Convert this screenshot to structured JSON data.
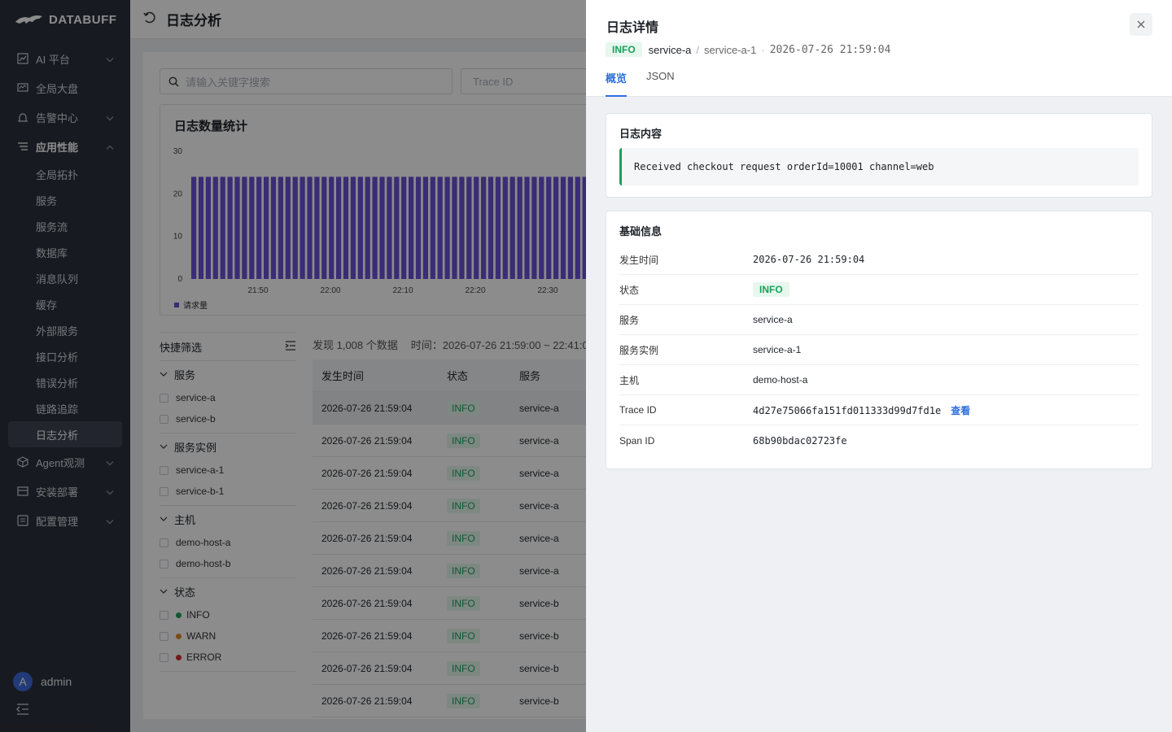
{
  "app": {
    "brand": "DATABUFF"
  },
  "sidebar": {
    "items": [
      {
        "label": "AI 平台"
      },
      {
        "label": "全局大盘"
      },
      {
        "label": "告警中心"
      },
      {
        "label": "应用性能"
      },
      {
        "label": "Agent观测"
      },
      {
        "label": "安装部署"
      },
      {
        "label": "配置管理"
      }
    ],
    "sub_items": [
      "全局拓扑",
      "服务",
      "服务流",
      "数据库",
      "消息队列",
      "缓存",
      "外部服务",
      "接口分析",
      "错误分析",
      "链路追踪",
      "日志分析"
    ],
    "user": {
      "initial": "A",
      "name": "admin"
    }
  },
  "page": {
    "title": "日志分析"
  },
  "search": {
    "placeholder": "请输入关键字搜索",
    "trace_placeholder": "Trace ID"
  },
  "chart_data": {
    "type": "bar",
    "title": "日志数量统计",
    "x_tick_labels": [
      "21:50",
      "22:00",
      "22:10",
      "22:20",
      "22:30"
    ],
    "ylim": [
      0,
      30
    ],
    "y_ticks": [
      0,
      10,
      20,
      30
    ],
    "series": [
      {
        "name": "请求量",
        "values": [
          24,
          24,
          24,
          24,
          24,
          24,
          24,
          24,
          24,
          24,
          24,
          24,
          24,
          24,
          24,
          24,
          24,
          24,
          24,
          24,
          24,
          24,
          24,
          24,
          24,
          24,
          24,
          24,
          24,
          24,
          24,
          24,
          24,
          24,
          24,
          24,
          24,
          24,
          24,
          24,
          24,
          24,
          24,
          24,
          24,
          24,
          24,
          24,
          24,
          24,
          24,
          24,
          24,
          24,
          24,
          24
        ]
      }
    ],
    "color": "#6a50d6"
  },
  "quick_filter": {
    "title": "快捷筛选",
    "groups": [
      {
        "title": "服务",
        "options": [
          "service-a",
          "service-b"
        ]
      },
      {
        "title": "服务实例",
        "options": [
          "service-a-1",
          "service-b-1"
        ]
      },
      {
        "title": "主机",
        "options": [
          "demo-host-a",
          "demo-host-b"
        ]
      },
      {
        "title": "状态",
        "options": [
          "INFO",
          "WARN",
          "ERROR"
        ]
      }
    ],
    "status_colors": {
      "INFO": "#1aa05a",
      "WARN": "#e08a2c",
      "ERROR": "#d02f2f"
    }
  },
  "results": {
    "count_text": "发现 1,008 个数据",
    "time_text": "时间：2026-07-26 21:59:00 ~ 22:41:0",
    "columns": [
      "发生时间",
      "状态",
      "服务"
    ],
    "rows": [
      [
        "2026-07-26 21:59:04",
        "INFO",
        "service-a"
      ],
      [
        "2026-07-26 21:59:04",
        "INFO",
        "service-a"
      ],
      [
        "2026-07-26 21:59:04",
        "INFO",
        "service-a"
      ],
      [
        "2026-07-26 21:59:04",
        "INFO",
        "service-a"
      ],
      [
        "2026-07-26 21:59:04",
        "INFO",
        "service-a"
      ],
      [
        "2026-07-26 21:59:04",
        "INFO",
        "service-a"
      ],
      [
        "2026-07-26 21:59:04",
        "INFO",
        "service-b"
      ],
      [
        "2026-07-26 21:59:04",
        "INFO",
        "service-b"
      ],
      [
        "2026-07-26 21:59:04",
        "INFO",
        "service-b"
      ],
      [
        "2026-07-26 21:59:04",
        "INFO",
        "service-b"
      ]
    ]
  },
  "drawer": {
    "title": "日志详情",
    "level": "INFO",
    "service": "service-a",
    "instance": "service-a-1",
    "time": "2026-07-26 21:59:04",
    "tabs": [
      "概览",
      "JSON"
    ],
    "log_section_title": "日志内容",
    "log_content": "Received checkout request orderId=10001 channel=web",
    "info_section_title": "基础信息",
    "fields": [
      {
        "key": "发生时间",
        "value": "2026-07-26 21:59:04"
      },
      {
        "key": "状态",
        "value": "INFO"
      },
      {
        "key": "服务",
        "value": "service-a"
      },
      {
        "key": "服务实例",
        "value": "service-a-1"
      },
      {
        "key": "主机",
        "value": "demo-host-a"
      },
      {
        "key": "Trace ID",
        "value": "4d27e75066fa151fd011333d99d7fd1e"
      },
      {
        "key": "Span ID",
        "value": "68b90bdac02723fe"
      }
    ],
    "view_link": "查看"
  }
}
